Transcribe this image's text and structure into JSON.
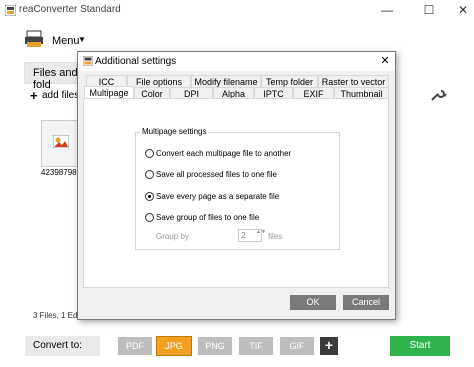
{
  "app": {
    "title": "reaConverter Standard",
    "minimize": "—",
    "maximize": "☐",
    "close": "✕"
  },
  "menu": {
    "label": "Menu",
    "caret": "▼"
  },
  "files_tab": {
    "label": "Files and fold"
  },
  "toolbar": {
    "add_files_plus": "+",
    "add_files_label": "add files"
  },
  "file_list": [
    {
      "name": "4239879812"
    }
  ],
  "status": {
    "text": "3  Files,  1  Edi"
  },
  "convert": {
    "label": "Convert to:",
    "formats": [
      {
        "label": "PDF",
        "selected": false
      },
      {
        "label": "JPG",
        "selected": true
      },
      {
        "label": "PNG",
        "selected": false
      },
      {
        "label": "TIF",
        "selected": false
      },
      {
        "label": "GIF",
        "selected": false
      }
    ],
    "add": "+",
    "start": "Start"
  },
  "dialog": {
    "title": "Additional settings",
    "close": "✕",
    "tabs_row1": [
      "ICC",
      "File options",
      "Modify filename",
      "Temp folder",
      "Raster to vector"
    ],
    "tabs_row2": [
      "Multipage",
      "Color",
      "DPI",
      "Alpha",
      "IPTC",
      "EXIF",
      "Thumbnail"
    ],
    "active_tab": "Multipage",
    "group_title": "Multipage settings",
    "options": [
      {
        "label": "Convert each multipage file to another",
        "checked": false
      },
      {
        "label": "Save all processed files to one file",
        "checked": false
      },
      {
        "label": "Save every page as a separate file",
        "checked": true
      },
      {
        "label": "Save group of files to one file",
        "checked": false
      }
    ],
    "group_by": {
      "label": "Group by",
      "value": "2",
      "unit": "files",
      "spin": "▲▼"
    },
    "ok": "OK",
    "cancel": "Cancel"
  },
  "colors": {
    "accent_selected": "#f0a020",
    "start": "#2fb34a"
  }
}
